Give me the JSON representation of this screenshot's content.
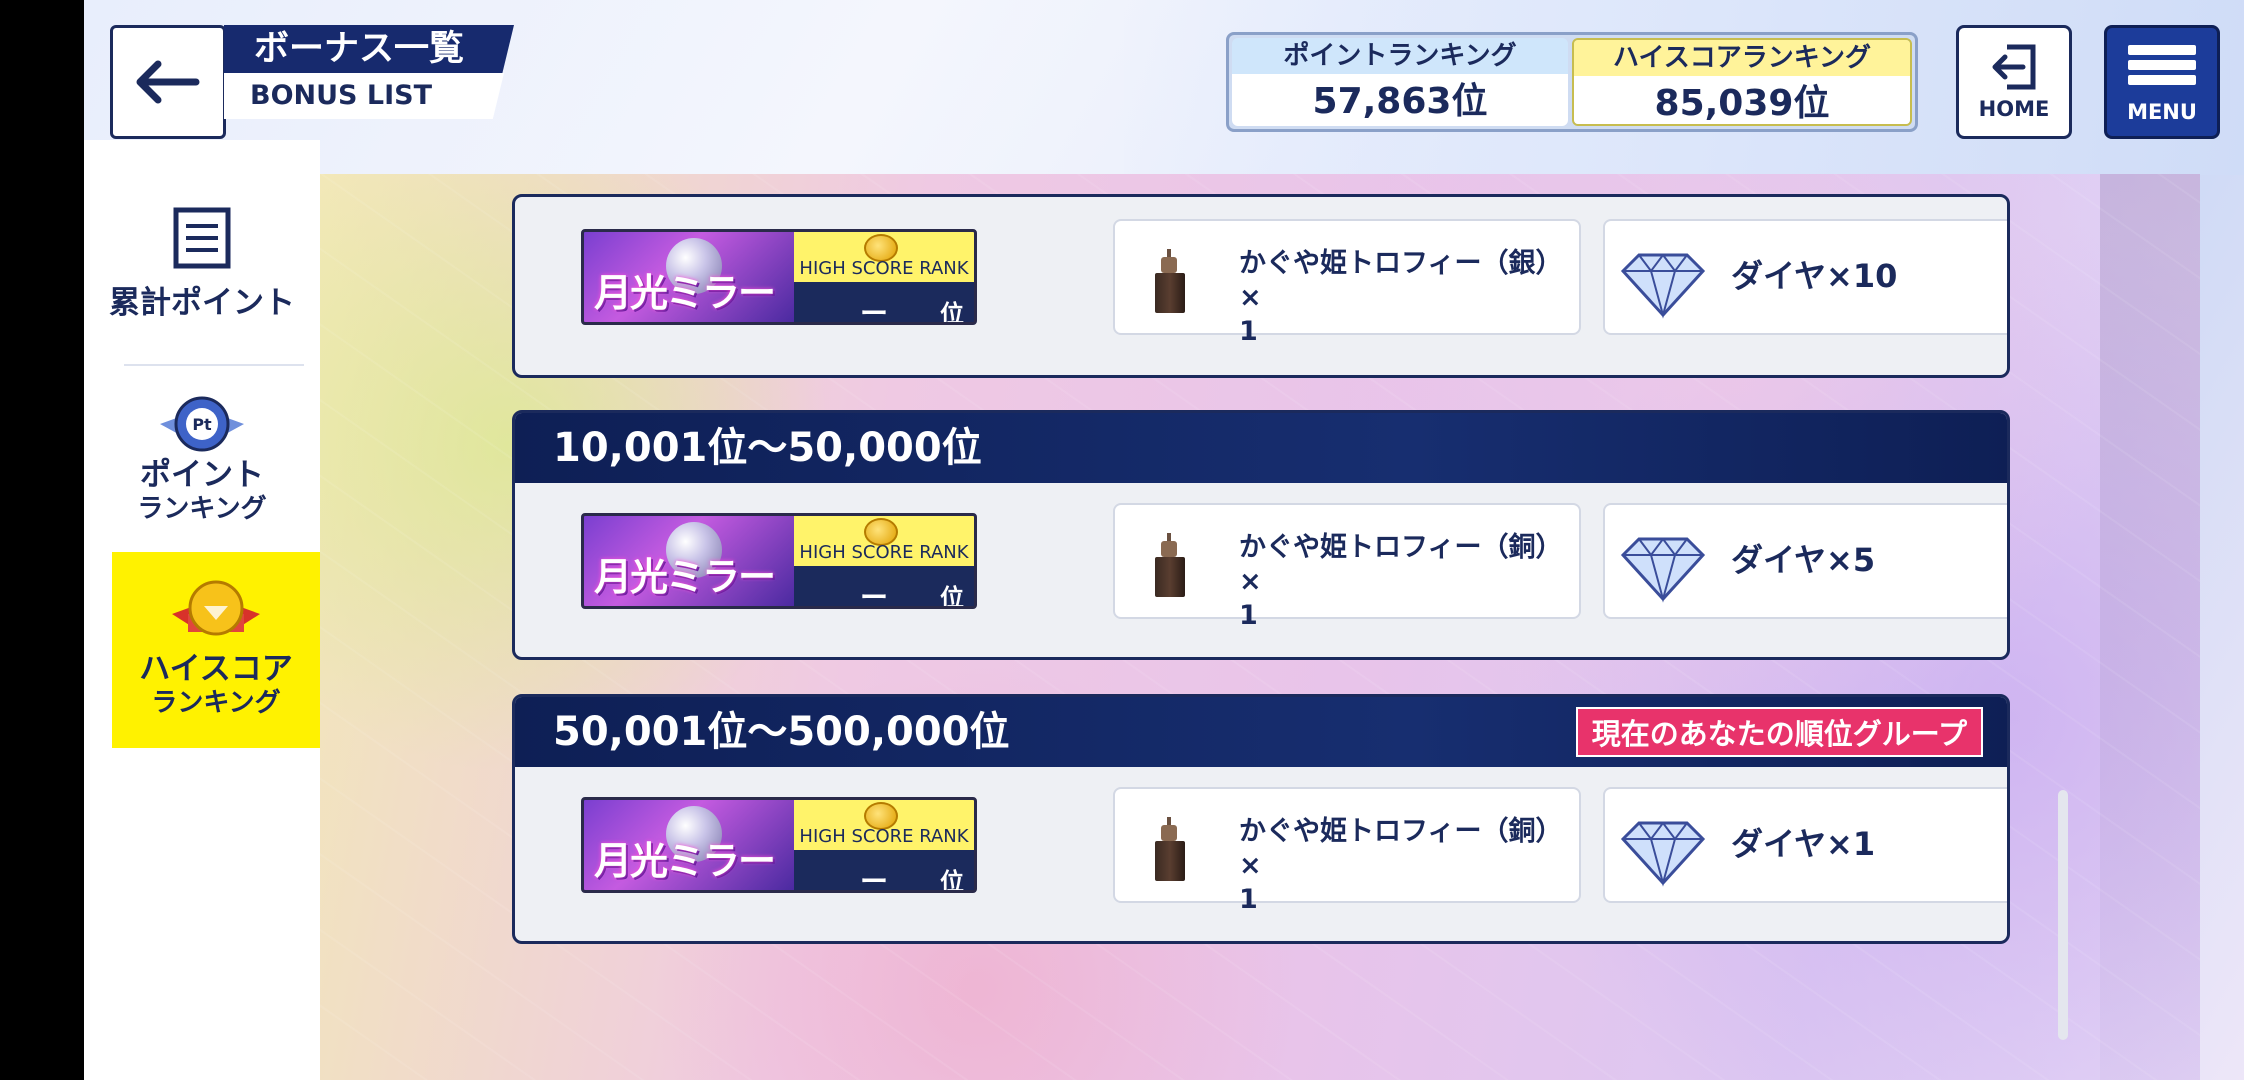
{
  "header": {
    "title_jp": "ボーナス一覧",
    "title_en": "BONUS LIST",
    "point_ranking": {
      "label": "ポイントランキング",
      "value": "57,863位"
    },
    "highscore_ranking": {
      "label": "ハイスコアランキング",
      "value": "85,039位"
    },
    "home_label": "HOME",
    "menu_label": "MENU"
  },
  "sidebar": {
    "items": [
      {
        "label1": "累計ポイント",
        "label2": "",
        "icon": "list-icon",
        "active": false
      },
      {
        "label1": "ポイント",
        "label2": "ランキング",
        "icon": "pt-medal-icon",
        "active": false
      },
      {
        "label1": "ハイスコア",
        "label2": "ランキング",
        "icon": "gold-medal-icon",
        "active": true
      }
    ]
  },
  "banner": {
    "title_art": "月光ミラーボール",
    "caption": "HIGH SCORE RANK",
    "rank_dash": "ー",
    "rank_suffix": "位"
  },
  "tiers": [
    {
      "range": "",
      "trophy": "かぐや姫トロフィー（銀）×\n1",
      "diamond": "ダイヤ×10"
    },
    {
      "range": "10,001位〜50,000位",
      "trophy": "かぐや姫トロフィー（銅）×\n1",
      "diamond": "ダイヤ×5"
    },
    {
      "range": "50,001位〜500,000位",
      "badge": "現在のあなたの順位グループ",
      "trophy": "かぐや姫トロフィー（銅）×\n1",
      "diamond": "ダイヤ×1"
    }
  ],
  "colors": {
    "navy": "#1b2a5c",
    "accent_yellow": "#fff200",
    "current_group_pink": "#e8336b",
    "menu_blue": "#1c3c9a"
  }
}
